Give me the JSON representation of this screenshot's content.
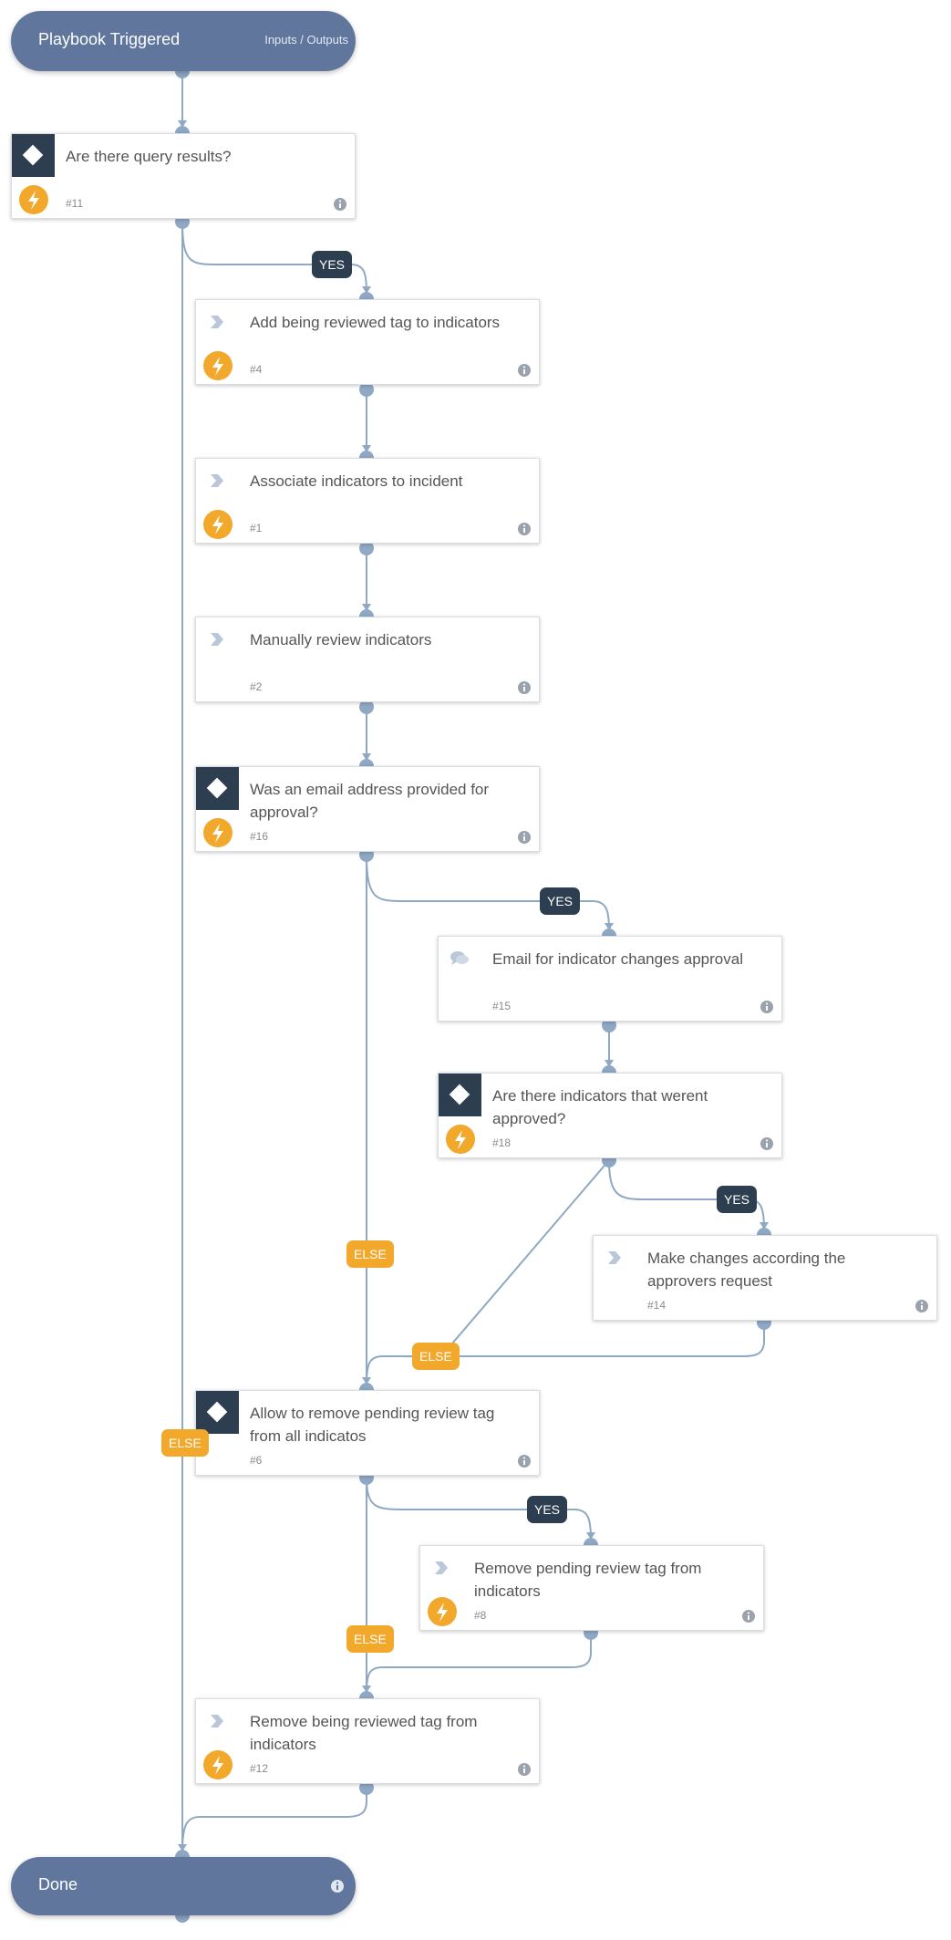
{
  "colors": {
    "pill": "#60769d",
    "connector": "#8fa8c4",
    "condition_dark": "#2d3e50",
    "yes_badge": "#2d3e50",
    "else_badge": "#f1a82b",
    "automation_icon": "#f1a82b"
  },
  "start": {
    "title": "Playbook Triggered",
    "link": "Inputs / Outputs"
  },
  "end": {
    "title": "Done",
    "icon": "info-icon"
  },
  "tasks": [
    {
      "id": "#11",
      "title": "Are there query results?",
      "type": "condition",
      "automation": true
    },
    {
      "id": "#4",
      "title": "Add being reviewed tag to indicators",
      "type": "regular",
      "automation": true
    },
    {
      "id": "#1",
      "title": "Associate indicators to incident",
      "type": "regular",
      "automation": true
    },
    {
      "id": "#2",
      "title": "Manually review indicators",
      "type": "regular",
      "automation": false
    },
    {
      "id": "#16",
      "title": "Was an email address provided for approval?",
      "type": "condition",
      "automation": true
    },
    {
      "id": "#15",
      "title": "Email for indicator changes approval",
      "type": "communication",
      "automation": false
    },
    {
      "id": "#18",
      "title": "Are there indicators that werent approved?",
      "type": "condition",
      "automation": true
    },
    {
      "id": "#14",
      "title": "Make changes according the approvers request",
      "type": "regular",
      "automation": false
    },
    {
      "id": "#6",
      "title": "Allow to remove pending review tag from all indicatos",
      "type": "condition",
      "automation": false
    },
    {
      "id": "#8",
      "title": "Remove pending review tag from indicators",
      "type": "regular",
      "automation": true
    },
    {
      "id": "#12",
      "title": "Remove being reviewed tag from indicators",
      "type": "regular",
      "automation": true
    }
  ],
  "badges": [
    {
      "label": "YES",
      "kind": "yes",
      "from": "#11"
    },
    {
      "label": "YES",
      "kind": "yes",
      "from": "#16"
    },
    {
      "label": "ELSE",
      "kind": "else",
      "from": "#16"
    },
    {
      "label": "YES",
      "kind": "yes",
      "from": "#18"
    },
    {
      "label": "ELSE",
      "kind": "else",
      "from": "#18"
    },
    {
      "label": "ELSE",
      "kind": "else",
      "from": "#11"
    },
    {
      "label": "YES",
      "kind": "yes",
      "from": "#6"
    },
    {
      "label": "ELSE",
      "kind": "else",
      "from": "#6"
    }
  ]
}
